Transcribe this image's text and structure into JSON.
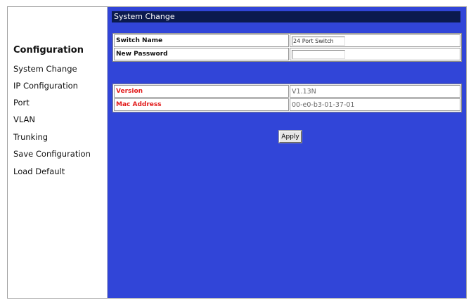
{
  "sidebar": {
    "heading": "Configuration",
    "items": [
      {
        "label": "System Change"
      },
      {
        "label": "IP Configuration"
      },
      {
        "label": "Port"
      },
      {
        "label": "VLAN"
      },
      {
        "label": "Trunking"
      },
      {
        "label": "Save Configuration"
      },
      {
        "label": "Load Default"
      }
    ]
  },
  "main": {
    "title": "System Change",
    "form": {
      "switch_name_label": "Switch Name",
      "switch_name_value": "24 Port Switch",
      "new_password_label": "New Password",
      "new_password_value": ""
    },
    "info": {
      "version_label": "Version",
      "version_value": "V1.13N",
      "mac_label": "Mac Address",
      "mac_value": "00-e0-b3-01-37-01"
    },
    "apply_label": "Apply"
  },
  "colors": {
    "content_background": "#3145d8",
    "title_bar": "#0b1a4e",
    "label_red": "#e21b1b"
  }
}
